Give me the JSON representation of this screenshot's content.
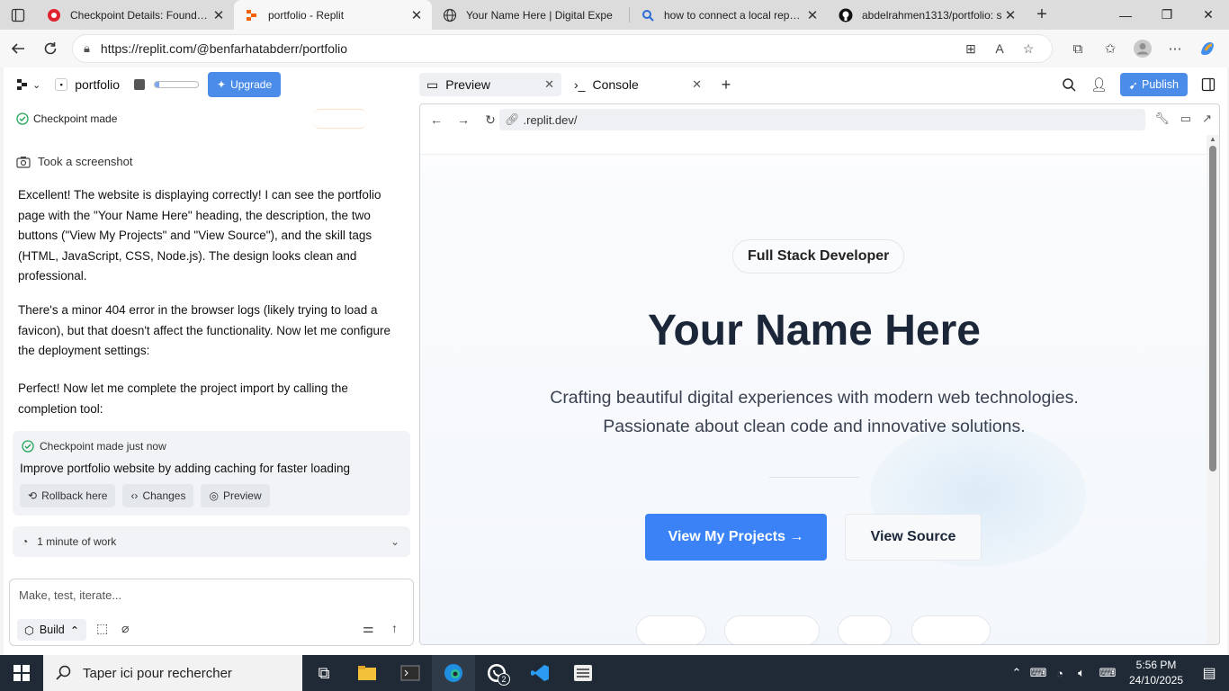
{
  "browser": {
    "tabs": [
      {
        "title": "Checkpoint Details: Foundation",
        "icon": "red-circle-icon"
      },
      {
        "title": "portfolio - Replit",
        "icon": "replit-icon",
        "active": true
      },
      {
        "title": "Your Name Here | Digital Expe",
        "icon": "globe-icon"
      },
      {
        "title": "how to connect a local reposit",
        "icon": "search-icon"
      },
      {
        "title": "abdelrahmen1313/portfolio: s",
        "icon": "github-icon"
      }
    ],
    "url": "https://replit.com/@benfarhatabderr/portfolio"
  },
  "replit": {
    "project_name": "portfolio",
    "upgrade_label": "Upgrade",
    "progress": 0.1,
    "checkpoint_top": "Checkpoint made",
    "screenshot_label": "Took a screenshot",
    "paragraphs": [
      "Excellent! The website is displaying correctly! I can see the portfolio page with the \"Your Name Here\" heading, the description, the two buttons (\"View My Projects\" and \"View Source\"), and the skill tags (HTML, JavaScript, CSS, Node.js). The design looks clean and professional.",
      "There's a minor 404 error in the browser logs (likely trying to load a favicon), but that doesn't affect the functionality. Now let me configure the deployment settings:",
      "Perfect! Now let me complete the project import by calling the completion tool:"
    ],
    "checkpoint_card": {
      "header": "Checkpoint made just now",
      "message": "Improve portfolio website by adding caching for faster loading",
      "buttons": [
        "Rollback here",
        "Changes",
        "Preview"
      ]
    },
    "work_label": "1 minute of work",
    "input_placeholder": "Make, test, iterate...",
    "build_label": "Build",
    "tabs": [
      "Preview",
      "Console"
    ],
    "publish_label": "Publish",
    "preview_url": ".replit.dev/"
  },
  "site": {
    "badge": "Full Stack Developer",
    "title": "Your Name Here",
    "description": "Crafting beautiful digital experiences with modern web technologies. Passionate about clean code and innovative solutions.",
    "primary_button": "View My Projects →",
    "secondary_button": "View Source"
  },
  "taskbar": {
    "search_placeholder": "Taper ici pour rechercher",
    "whatsapp_badge": "2",
    "time": "5:56 PM",
    "date": "24/10/2025"
  }
}
